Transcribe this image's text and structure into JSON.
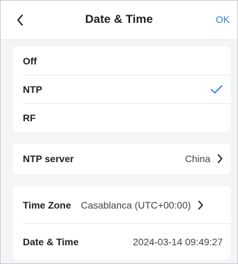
{
  "header": {
    "title": "Date & Time",
    "ok_label": "OK"
  },
  "mode": {
    "options": [
      {
        "label": "Off",
        "selected": false
      },
      {
        "label": "NTP",
        "selected": true
      },
      {
        "label": "RF",
        "selected": false
      }
    ]
  },
  "ntp_server": {
    "label": "NTP server",
    "value": "China"
  },
  "time_zone": {
    "label": "Time Zone",
    "value": "Casablanca (UTC+00:00)"
  },
  "date_time": {
    "label": "Date & Time",
    "value": "2024-03-14 09:49:27"
  },
  "colors": {
    "accent": "#2d7de0",
    "background": "#f4f5f7",
    "card": "#ffffff"
  },
  "icons": {
    "back": "chevron-left-icon",
    "selected": "checkmark-icon",
    "more": "chevron-right-icon"
  }
}
